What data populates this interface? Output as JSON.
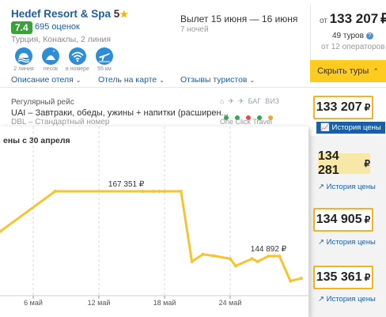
{
  "hotel": {
    "name": "Hedef Resort & Spa",
    "stars": "5",
    "rating": "7.4",
    "reviews": "695 оценок",
    "location": "Турция, Конаклы, 2 линия",
    "amenities": [
      {
        "icon": "beach-line-icon",
        "label": "2 линия"
      },
      {
        "icon": "sand-icon",
        "label": "песок"
      },
      {
        "icon": "wifi-icon",
        "label": "в номере"
      },
      {
        "icon": "airport-icon",
        "label": "55 км"
      }
    ],
    "links": {
      "description": "Описание отеля",
      "map": "Отель на карте",
      "reviews": "Отзывы туристов"
    }
  },
  "trip": {
    "dates": "Вылет 15 июня — 16 июня",
    "nights": "7 ночей"
  },
  "summary": {
    "from_label": "от",
    "from_price": "133 207",
    "currency": "₽",
    "tours": "49 туров",
    "operators": "от 12 операторов",
    "hide_button": "Скрыть туры"
  },
  "offer": {
    "flight_type": "Регулярный рейс",
    "meal": "UAI – Завтраки, обеды, ужины + напитки (расширен...",
    "room": "DBL – Стандартный номер",
    "operator": "One Click Travel",
    "baggage_label": "БАГ",
    "visa_label": "ВИЗ",
    "status_colors": [
      "#2fa84f",
      "#2fa84f",
      "#e84b3c",
      "#2fa84f",
      "#f5a623"
    ]
  },
  "prices": [
    {
      "value": "133 207",
      "history": "История цены"
    },
    {
      "value": "134 281",
      "history": "История цены"
    },
    {
      "value": "134 905",
      "history": "История цены"
    },
    {
      "value": "135 361",
      "history": "История цены"
    }
  ],
  "active_history_tab": "История цены",
  "chart_title": "ены с 30 апреля",
  "chart_data": {
    "type": "line",
    "color": "#f6c430",
    "x_ticks": [
      "6 май",
      "12 май",
      "18 май",
      "24 май"
    ],
    "x": [
      -2,
      0,
      1,
      3,
      8,
      16,
      17,
      17.5,
      18,
      19.5,
      20.5,
      21.5,
      22.5,
      24,
      24.5,
      26,
      26.5,
      27.5,
      28,
      28.5,
      29.5,
      30.5
    ],
    "values": [
      152500,
      152500,
      153000,
      153500,
      167351,
      167351,
      167351,
      167351,
      167351,
      167351,
      143000,
      145500,
      145000,
      144000,
      141500,
      144000,
      143000,
      144892,
      144892,
      144892,
      136300,
      137200
    ],
    "annotations": [
      {
        "x": 14.5,
        "value": 167351,
        "label": "167 351 ₽"
      },
      {
        "x": 27.5,
        "value": 144892,
        "label": "144 892 ₽"
      }
    ],
    "currency": "₽",
    "grid": "vertical dashed"
  }
}
